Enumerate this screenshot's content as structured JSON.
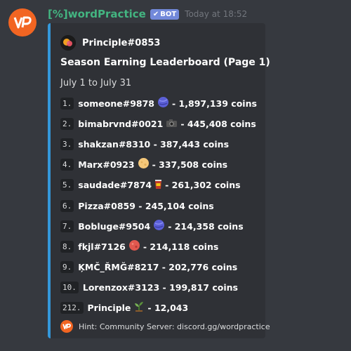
{
  "message": {
    "username": "[%]wordPractice",
    "bot_tag": "BOT",
    "timestamp": "Today at 18:52",
    "avatar_text": "VP"
  },
  "embed": {
    "accent_color": "#3498db",
    "author": "Principle#0853",
    "title": "Season Earning Leaderboard (Page 1)",
    "subtitle": "July 1 to July 31",
    "rows": [
      {
        "rank": "1.",
        "name": "someone#9878",
        "emoji": "planet-icon",
        "coins": "- 1,897,139 coins"
      },
      {
        "rank": "2.",
        "name": "bimabrvnd#0021",
        "emoji": "camera-icon",
        "coins": "- 445,408 coins"
      },
      {
        "rank": "3.",
        "name": "shakzan#8310",
        "emoji": "",
        "coins": " - 387,443 coins"
      },
      {
        "rank": "4.",
        "name": "Marx#0923",
        "emoji": "moon-icon",
        "coins": "- 337,508 coins"
      },
      {
        "rank": "5.",
        "name": "saudade#7874",
        "emoji": "drink-icon",
        "coins": "- 261,302 coins"
      },
      {
        "rank": "6.",
        "name": "Pizza#0859",
        "emoji": "",
        "coins": " - 245,104 coins"
      },
      {
        "rank": "7.",
        "name": "Bobluge#9504",
        "emoji": "planet-icon",
        "coins": "- 214,358 coins"
      },
      {
        "rank": "8.",
        "name": "fkjl#7126",
        "emoji": "red-moon-icon",
        "coins": "- 214,118 coins"
      },
      {
        "rank": "9.",
        "name": "ĶMČ_ŘMĞ#8217",
        "emoji": "",
        "coins": " - 202,776 coins"
      },
      {
        "rank": "10.",
        "name": "Lorenzox#3123",
        "emoji": "",
        "coins": " - 199,817 coins"
      },
      {
        "rank": "212.",
        "name": "Principle",
        "emoji": "seedling-icon",
        "coins": "- 12,043"
      }
    ],
    "footer": "Hint: Community Server: discord.gg/wordpractice"
  }
}
